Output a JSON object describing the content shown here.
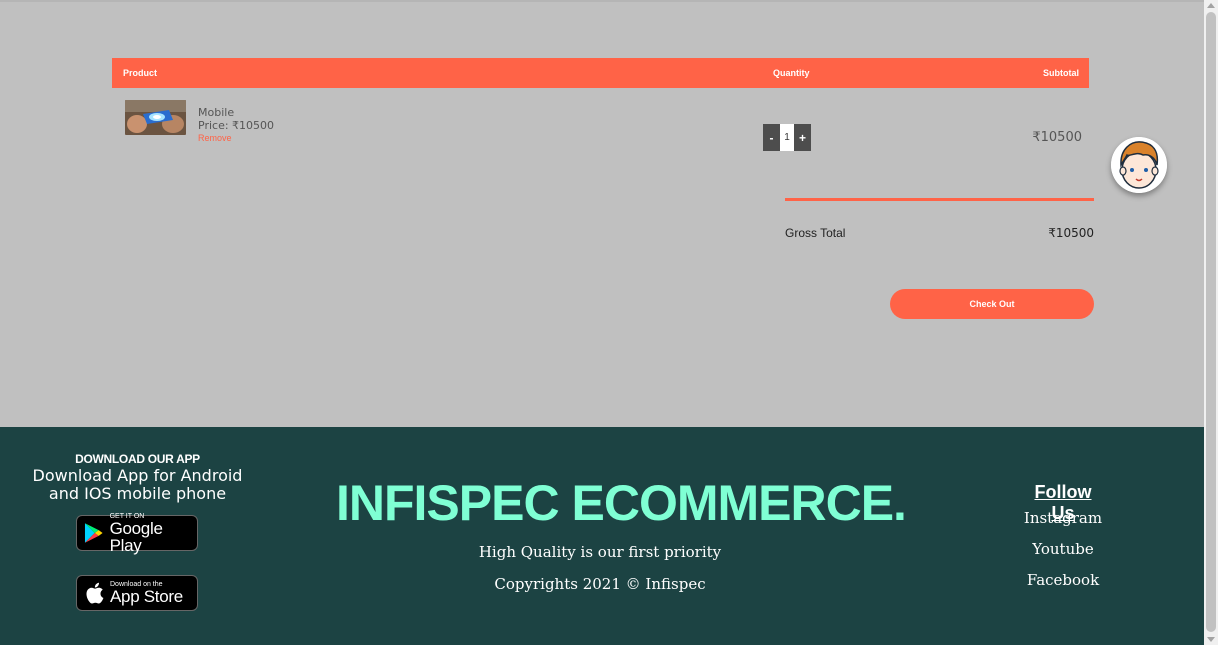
{
  "cart": {
    "headers": {
      "product": "Product",
      "quantity": "Quantity",
      "subtotal": "Subtotal"
    },
    "items": [
      {
        "name": "Mobile",
        "price_text": "Price: ₹10500",
        "remove_label": "Remove",
        "quantity": "1",
        "subtotal": "₹10500"
      }
    ],
    "gross_total_label": "Gross Total",
    "gross_total_value": "₹10500",
    "checkout_label": "Check Out",
    "qty_minus": "-",
    "qty_plus": "+"
  },
  "footer": {
    "download_title": "DOWNLOAD OUR APP",
    "download_subtitle": "Download App for Android and IOS mobile phone",
    "google_badge": {
      "small": "GET IT ON",
      "big": "Google Play"
    },
    "apple_badge": {
      "small": "Download on the",
      "big": "App Store"
    },
    "brand": "INFISPEC ECOMMERCE.",
    "tagline": "High Quality is our first priority",
    "copyright": "Copyrights 2021 © Infispec",
    "follow_title": "Follow Us",
    "social_links": [
      "Instagram",
      "Youtube",
      "Facebook"
    ]
  },
  "colors": {
    "accent": "#ff6347",
    "footer_bg": "#1c4343",
    "brand_text": "#7fffd4",
    "page_bg": "#c0c0c0"
  },
  "icons": [
    "product-thumbnail",
    "avatar-icon",
    "google-play-icon",
    "apple-icon"
  ]
}
